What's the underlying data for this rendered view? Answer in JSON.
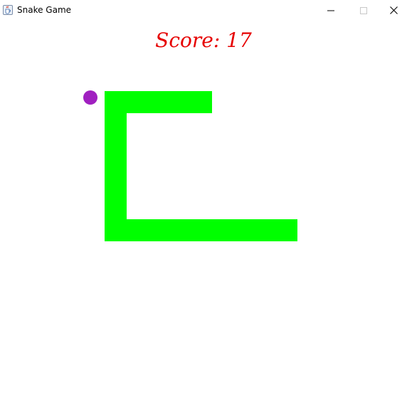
{
  "window": {
    "title": "Snake Game",
    "icon": "java-cup-icon",
    "controls": [
      "minimize-icon",
      "maximize-icon",
      "close-icon"
    ]
  },
  "game": {
    "score_text": "Score: 17",
    "score_color": "#e60000",
    "snake_color": "#00ff00",
    "food_color": "#a020c0",
    "background_color": "#ffffff"
  }
}
